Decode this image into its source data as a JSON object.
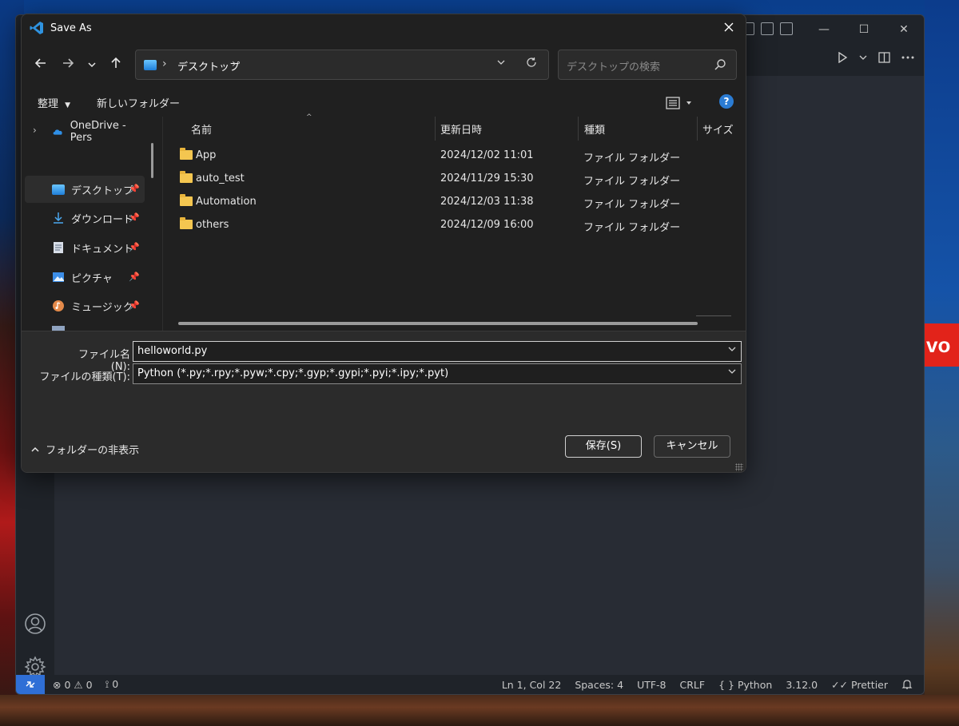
{
  "vscode": {
    "window_controls": {
      "minimize": "—",
      "maximize": "☐",
      "close": "✕"
    },
    "statusbar": {
      "errors": "0",
      "warnings": "0",
      "ports": "0",
      "position": "Ln 1, Col 22",
      "spaces": "Spaces: 4",
      "encoding": "UTF-8",
      "eol": "CRLF",
      "language": "Python",
      "language_prefix": "{ }",
      "version": "3.12.0",
      "prettier": "Prettier"
    }
  },
  "dialog": {
    "title": "Save As",
    "address": {
      "path": "デスクトップ"
    },
    "search": {
      "placeholder": "デスクトップの検索"
    },
    "commands": {
      "organize": "整理",
      "new_folder": "新しいフォルダー"
    },
    "help": "?",
    "nav_items": [
      {
        "label": "OneDrive - Pers"
      },
      {
        "label": "デスクトップ"
      },
      {
        "label": "ダウンロード"
      },
      {
        "label": "ドキュメント"
      },
      {
        "label": "ピクチャ"
      },
      {
        "label": "ミュージック"
      }
    ],
    "columns": {
      "name": "名前",
      "date": "更新日時",
      "type": "種類",
      "size": "サイズ"
    },
    "files": [
      {
        "name": "App",
        "date": "2024/12/02 11:01",
        "type": "ファイル フォルダー"
      },
      {
        "name": "auto_test",
        "date": "2024/11/29 15:30",
        "type": "ファイル フォルダー"
      },
      {
        "name": "Automation",
        "date": "2024/12/03 11:38",
        "type": "ファイル フォルダー"
      },
      {
        "name": "others",
        "date": "2024/12/09 16:00",
        "type": "ファイル フォルダー"
      }
    ],
    "filename_label": "ファイル名(N):",
    "filename_value": "helloworld.py",
    "filetype_label": "ファイルの種類(T):",
    "filetype_value": "Python (*.py;*.rpy;*.pyw;*.cpy;*.gyp;*.gypi;*.pyi;*.ipy;*.pyt)",
    "hide_folders": "フォルダーの非表示",
    "save_button": "保存(S)",
    "cancel_button": "キャンセル"
  },
  "desktop": {
    "brand_text": "vo"
  }
}
